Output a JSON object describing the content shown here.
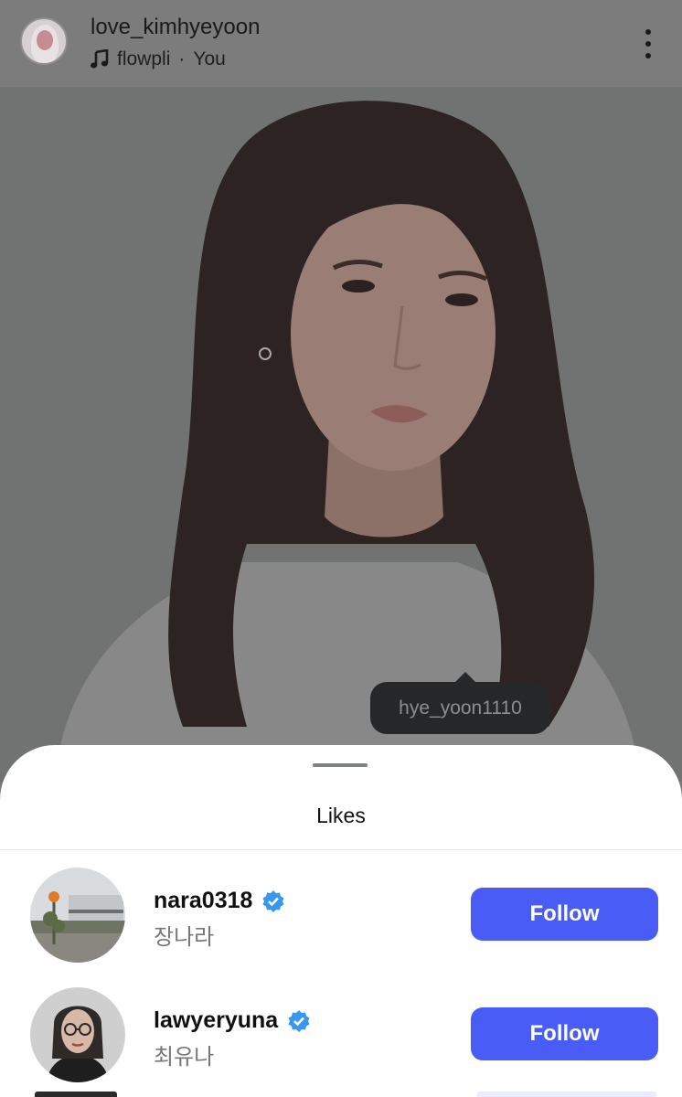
{
  "post": {
    "username": "love_kimhyeyoon",
    "audio_label": "flowpli",
    "audio_separator": "·",
    "audio_owner": "You",
    "icons": {
      "avatar": "profile-avatar",
      "music": "music-note-icon",
      "more": "more-vertical-icon"
    }
  },
  "photo": {
    "tag_username": "hye_yoon1110"
  },
  "likes_sheet": {
    "title": "Likes",
    "users": [
      {
        "username": "nara0318",
        "fullname": "장나라",
        "verified": true,
        "button_label": "Follow"
      },
      {
        "username": "lawyeryuna",
        "fullname": "최유나",
        "verified": true,
        "button_label": "Follow"
      }
    ]
  },
  "colors": {
    "follow_button": "#4a5cf6",
    "verified_badge": "#3897f0",
    "dim_overlay": "#7a7a7a"
  }
}
